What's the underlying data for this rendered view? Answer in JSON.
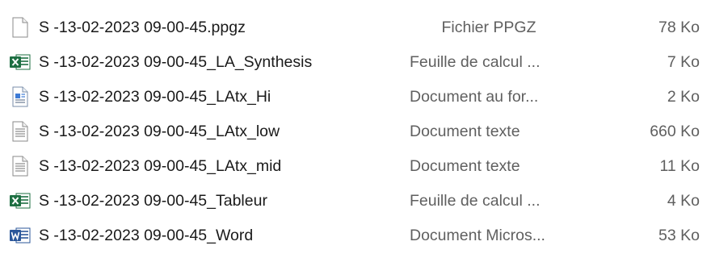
{
  "files": [
    {
      "name": "S -13-02-2023 09-00-45.ppgz",
      "type": "Fichier PPGZ",
      "size": "78 Ko",
      "icon": "blank-file-icon"
    },
    {
      "name": "S -13-02-2023 09-00-45_LA_Synthesis",
      "type": "Feuille de calcul ...",
      "size": "7 Ko",
      "icon": "excel-file-icon"
    },
    {
      "name": "S -13-02-2023 09-00-45_LAtx_Hi",
      "type": "Document au for...",
      "size": "2 Ko",
      "icon": "rtf-file-icon"
    },
    {
      "name": "S -13-02-2023 09-00-45_LAtx_low",
      "type": "Document texte",
      "size": "660 Ko",
      "icon": "text-file-icon"
    },
    {
      "name": "S -13-02-2023 09-00-45_LAtx_mid",
      "type": "Document texte",
      "size": "11 Ko",
      "icon": "text-file-icon"
    },
    {
      "name": "S -13-02-2023 09-00-45_Tableur",
      "type": "Feuille de calcul ...",
      "size": "4 Ko",
      "icon": "excel-file-icon"
    },
    {
      "name": "S -13-02-2023 09-00-45_Word",
      "type": "Document Micros...",
      "size": "53 Ko",
      "icon": "word-file-icon"
    }
  ],
  "colors": {
    "excel": "#1d6f42",
    "word": "#2b579a",
    "type_text": "#5f5f5f",
    "name_text": "#1a1a1a"
  }
}
